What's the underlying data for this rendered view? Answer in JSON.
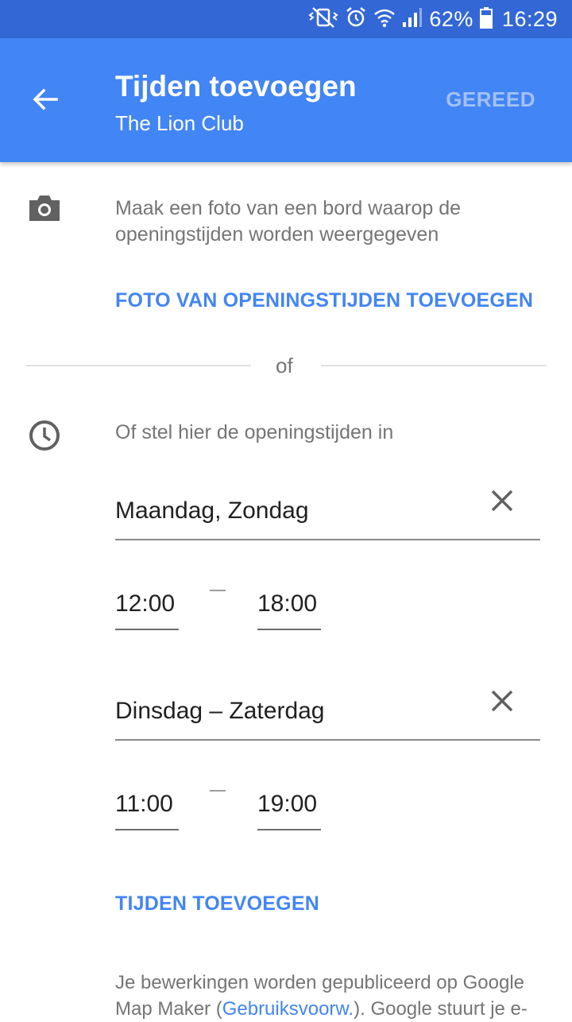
{
  "status_bar": {
    "battery": "62%",
    "time": "16:29",
    "icons": [
      "mute-vibrate-icon",
      "alarm-icon",
      "wifi-icon",
      "signal-icon",
      "battery-icon"
    ]
  },
  "app_bar": {
    "title": "Tijden toevoegen",
    "subtitle": "The Lion Club",
    "done_label": "GEREED",
    "background": "#4285f4",
    "status_background": "#3367d6"
  },
  "photo_section": {
    "description": "Maak een foto van een bord waarop de openingstijden worden weergegeven",
    "add_photo_label": "FOTO VAN OPENINGSTIJDEN TOEVOEGEN"
  },
  "divider_label": "of",
  "hours_section": {
    "prompt": "Of stel hier de openingstijden in",
    "entries": [
      {
        "days": "Maandag, Zondag",
        "open": "12:00",
        "close": "18:00"
      },
      {
        "days": "Dinsdag – Zaterdag",
        "open": "11:00",
        "close": "19:00"
      }
    ],
    "add_hours_label": "TIJDEN TOEVOEGEN"
  },
  "footer": {
    "text_before": "Je bewerkingen worden gepubliceerd op Google Map Maker (",
    "link_text": "Gebruiksvoorw.",
    "text_after": "). Google stuurt je e-"
  },
  "accent_color": "#4285f4"
}
